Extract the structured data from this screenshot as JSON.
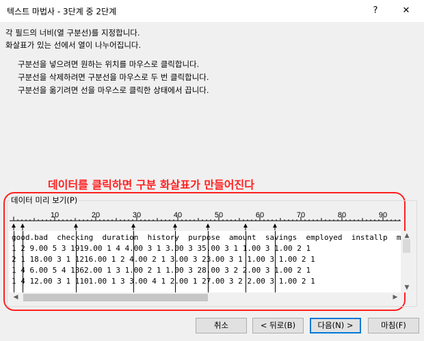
{
  "window": {
    "title": "텍스트 마법사 - 3단계 중 2단계",
    "help_glyph": "?",
    "close_glyph": "✕"
  },
  "instructions": {
    "line1": "각 필드의 너비(열 구분선)를 지정합니다.",
    "line2": "화살표가 있는 선에서 열이 나누어집니다.",
    "bullet1": "구분선을 넣으려면 원하는 위치를 마우스로 클릭합니다.",
    "bullet2": "구분선을 삭제하려면 구분선을 마우스로 두 번 클릭합니다.",
    "bullet3": "구분선을 옮기려면 선을 마우스로 클릭한 상태에서 끕니다."
  },
  "annotation": {
    "text": "데이터를 클릭하면 구분 화살표가 만들어진다",
    "color": "#ff2020"
  },
  "preview": {
    "label": "데이터 미리 보기(P)",
    "ruler_ticks": [
      "10",
      "20",
      "30",
      "40",
      "50",
      "60",
      "70",
      "80",
      "90"
    ],
    "lines": [
      "good.bad  checking  duration  history  purpose  amount  savings  employed  installp  martial  c",
      "1 2 9.00 5 3 1919.00 1 4 4.00 3 1 3.00 3 35.00 3 1 1.00 3 1.00 2 1",
      "2 1 18.00 3 1 1216.00 1 2 4.00 2 1 3.00 3 23.00 3 1 1.00 3 1.00 2 1",
      "1 4 6.00 5 4 1362.00 1 3 1.00 2 1 1.00 3 28.00 3 2 2.00 3 1.00 2 1",
      "1 4 12.00 3 1 1101.00 1 3 3.00 4 1 2.00 1 27.00 3 2 2.00 3 1.00 2 1"
    ]
  },
  "buttons": {
    "cancel": "취소",
    "back": "< 뒤로(B)",
    "next": "다음(N) >",
    "finish": "마침(F)"
  }
}
